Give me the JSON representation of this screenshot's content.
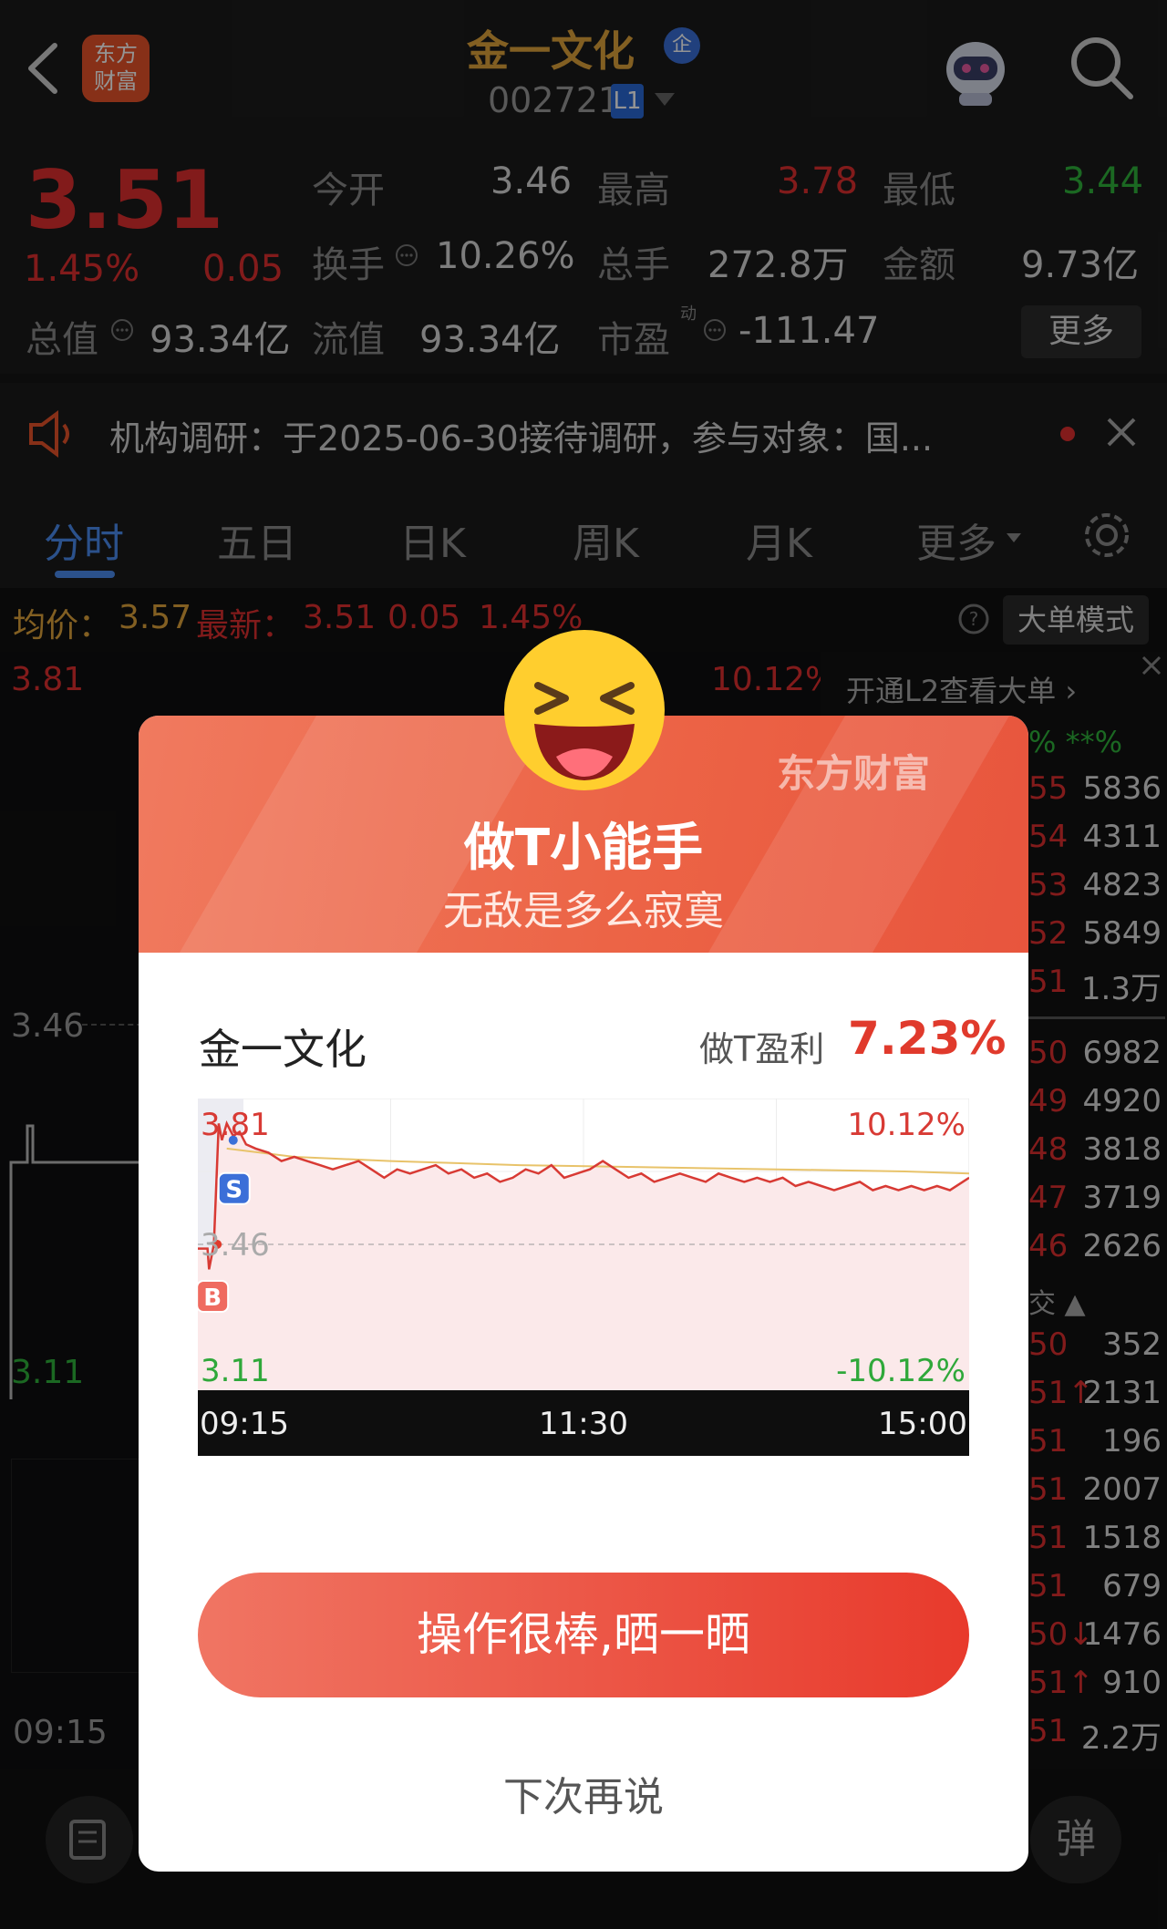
{
  "header": {
    "back_icon": "chevron-left-icon",
    "logo_text": "东方\n财富",
    "stock_name": "金一文化",
    "badge": "企",
    "stock_code": "002721",
    "level_badge": "L1"
  },
  "quote": {
    "price": "3.51",
    "change_pct": "1.45%",
    "change": "0.05",
    "open_label": "今开",
    "open": "3.46",
    "high_label": "最高",
    "high": "3.78",
    "low_label": "最低",
    "low": "3.44",
    "turnover_label": "换手",
    "turnover": "10.26%",
    "volume_label": "总手",
    "volume": "272.8万",
    "amount_label": "金额",
    "amount": "9.73亿",
    "mktcap_label": "总值",
    "mktcap": "93.34亿",
    "float_label": "流值",
    "float": "93.34亿",
    "pe_label": "市盈",
    "pe_sup": "动",
    "pe": "-111.47",
    "more_label": "更多"
  },
  "notice": {
    "text": "机构调研：于2025-06-30接待调研，参与对象：国..."
  },
  "tabs": [
    "分时",
    "五日",
    "日K",
    "周K",
    "月K",
    "更多"
  ],
  "chart_header": {
    "avg_label": "均价：",
    "avg": "3.57",
    "latest_label": "最新：",
    "latest": "3.51",
    "chg": "0.05",
    "chg_pct": "1.45%",
    "mode_label": "大单模式"
  },
  "bg_chart": {
    "top": "3.81",
    "top_pct": "10.12%",
    "mid": "3.46",
    "bottom": "3.11",
    "time": "09:15"
  },
  "right_panel": {
    "l2_text": "开通L2查看大单 ›",
    "pct_row": "% **%",
    "asks": [
      {
        "p": "55",
        "v1": "58",
        "v2": "36"
      },
      {
        "p": "54",
        "v1": "43",
        "v2": "11"
      },
      {
        "p": "53",
        "v1": "48",
        "v2": "23"
      },
      {
        "p": "52",
        "v1": "58",
        "v2": "49"
      },
      {
        "p": "51",
        "v1": "",
        "v2": "1.3万"
      }
    ],
    "bids": [
      {
        "p": "50",
        "v1": "69",
        "v2": "82"
      },
      {
        "p": "49",
        "v1": "49",
        "v2": "20"
      },
      {
        "p": "48",
        "v1": "38",
        "v2": "18"
      },
      {
        "p": "47",
        "v1": "37",
        "v2": "19"
      },
      {
        "p": "46",
        "v1": "26",
        "v2": "26"
      }
    ],
    "trade_label": "交 ▲",
    "trades": [
      {
        "p": "50",
        "v": "352"
      },
      {
        "p": "51↑",
        "v": "2131"
      },
      {
        "p": "51",
        "v": "196"
      },
      {
        "p": "51",
        "v": "2007"
      },
      {
        "p": "51",
        "v": "1518"
      },
      {
        "p": "51",
        "v": "679"
      },
      {
        "p": "50↓",
        "v": "1476"
      },
      {
        "p": "51↑",
        "v": "910"
      },
      {
        "p": "51",
        "v": "2.2万"
      }
    ]
  },
  "modal": {
    "title": "做T小能手",
    "subtitle": "无敌是多么寂寞",
    "brand": "东方财富",
    "stock": "金一文化",
    "profit_label": "做T盈利",
    "profit": "7.23%",
    "cta": "操作很棒,晒一晒",
    "dismiss": "下次再说"
  },
  "chart_data": {
    "type": "line",
    "x_ticks": [
      "09:15",
      "11:30",
      "15:00"
    ],
    "y_ticks_left": [
      "3.81",
      "3.46",
      "3.11"
    ],
    "y_ticks_right": [
      "10.12%",
      "-10.12%"
    ],
    "ylim": [
      3.11,
      3.81
    ],
    "reference": 3.46,
    "series": [],
    "price_line": [
      [
        0,
        3.45
      ],
      [
        3,
        3.45
      ],
      [
        3.5,
        3.4
      ],
      [
        5,
        3.46
      ],
      [
        6.5,
        3.75
      ],
      [
        7.5,
        3.71
      ],
      [
        9,
        3.75
      ],
      [
        11,
        3.72
      ],
      [
        13,
        3.73
      ],
      [
        15,
        3.7
      ],
      [
        18,
        3.69
      ],
      [
        22,
        3.68
      ],
      [
        26,
        3.66
      ],
      [
        30,
        3.67
      ],
      [
        34,
        3.66
      ],
      [
        38,
        3.65
      ],
      [
        42,
        3.64
      ],
      [
        46,
        3.65
      ],
      [
        50,
        3.66
      ],
      [
        54,
        3.64
      ],
      [
        58,
        3.62
      ],
      [
        62,
        3.64
      ],
      [
        66,
        3.63
      ],
      [
        70,
        3.64
      ],
      [
        74,
        3.65
      ],
      [
        78,
        3.63
      ],
      [
        82,
        3.64
      ],
      [
        86,
        3.62
      ],
      [
        90,
        3.63
      ],
      [
        94,
        3.61
      ],
      [
        98,
        3.62
      ],
      [
        102,
        3.64
      ],
      [
        106,
        3.63
      ],
      [
        110,
        3.65
      ],
      [
        114,
        3.62
      ],
      [
        118,
        3.63
      ],
      [
        122,
        3.64
      ],
      [
        126,
        3.66
      ],
      [
        130,
        3.64
      ],
      [
        134,
        3.62
      ],
      [
        138,
        3.63
      ],
      [
        142,
        3.61
      ],
      [
        146,
        3.62
      ],
      [
        150,
        3.63
      ],
      [
        154,
        3.62
      ],
      [
        158,
        3.61
      ],
      [
        162,
        3.63
      ],
      [
        166,
        3.62
      ],
      [
        170,
        3.61
      ],
      [
        174,
        3.62
      ],
      [
        178,
        3.61
      ],
      [
        182,
        3.62
      ],
      [
        186,
        3.6
      ],
      [
        190,
        3.61
      ],
      [
        194,
        3.6
      ],
      [
        198,
        3.59
      ],
      [
        202,
        3.6
      ],
      [
        206,
        3.61
      ],
      [
        210,
        3.59
      ],
      [
        214,
        3.6
      ],
      [
        218,
        3.59
      ],
      [
        222,
        3.6
      ],
      [
        226,
        3.59
      ],
      [
        230,
        3.6
      ],
      [
        234,
        3.59
      ],
      [
        238,
        3.61
      ],
      [
        240,
        3.62
      ]
    ],
    "avg_line": [
      [
        9,
        3.69
      ],
      [
        30,
        3.67
      ],
      [
        60,
        3.66
      ],
      [
        100,
        3.65
      ],
      [
        140,
        3.645
      ],
      [
        180,
        3.64
      ],
      [
        220,
        3.635
      ],
      [
        240,
        3.63
      ]
    ],
    "x_max": 240,
    "markers": [
      {
        "label": "S",
        "x": 11,
        "y": 3.71
      },
      {
        "label": "B",
        "x": 6,
        "y": 3.46
      }
    ]
  },
  "bottom": {
    "btn_icon": "note-icon",
    "right_icon": "danmaku-icon",
    "right_text": "弹"
  },
  "colors": {
    "up": "#e02f2f",
    "down": "#2fb43c",
    "accent": "#3b82f6",
    "gold": "#e0a43c",
    "modal_red": "#e8553d"
  }
}
